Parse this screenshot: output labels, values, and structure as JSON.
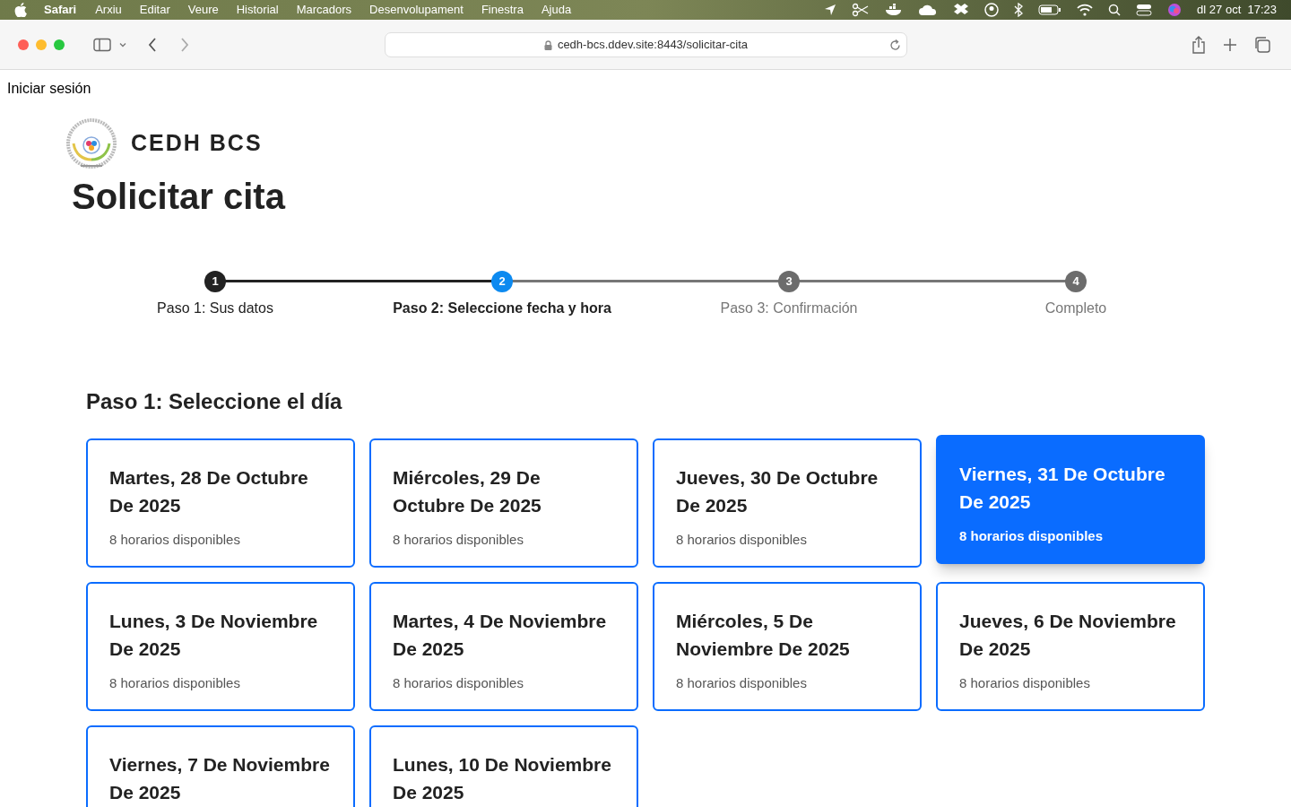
{
  "menu_bar": {
    "app": "Safari",
    "items": [
      "Arxiu",
      "Editar",
      "Veure",
      "Historial",
      "Marcadors",
      "Desenvolupament",
      "Finestra",
      "Ajuda"
    ],
    "clock": "dl 27 oct  17:23"
  },
  "browser": {
    "url": "cedh-bcs.ddev.site:8443/solicitar-cita"
  },
  "login_link": "Iniciar sesión",
  "brand": "CEDH BCS",
  "page_title": "Solicitar cita",
  "steps": [
    {
      "number": "1",
      "label": "Paso 1: Sus datos",
      "completed": true,
      "current": false
    },
    {
      "number": "2",
      "label": "Paso 2: Seleccione fecha y hora",
      "completed": false,
      "current": true
    },
    {
      "number": "3",
      "label": "Paso 3: Confirmación",
      "completed": false,
      "current": false
    },
    {
      "number": "4",
      "label": "Completo",
      "completed": false,
      "current": false
    }
  ],
  "section_title": "Paso 1: Seleccione el día",
  "days": [
    {
      "date": "Martes, 28 De Octubre De 2025",
      "slots": "8 horarios disponibles",
      "selected": false
    },
    {
      "date": "Miércoles, 29 De Octubre De 2025",
      "slots": "8 horarios disponibles",
      "selected": false
    },
    {
      "date": "Jueves, 30 De Octubre De 2025",
      "slots": "8 horarios disponibles",
      "selected": false
    },
    {
      "date": "Viernes, 31 De Octubre De 2025",
      "slots": "8 horarios disponibles",
      "selected": true
    },
    {
      "date": "Lunes, 3 De Noviembre De 2025",
      "slots": "8 horarios disponibles",
      "selected": false
    },
    {
      "date": "Martes, 4 De Noviembre De 2025",
      "slots": "8 horarios disponibles",
      "selected": false
    },
    {
      "date": "Miércoles, 5 De Noviembre De 2025",
      "slots": "8 horarios disponibles",
      "selected": false
    },
    {
      "date": "Jueves, 6 De Noviembre De 2025",
      "slots": "8 horarios disponibles",
      "selected": false
    },
    {
      "date": "Viernes, 7 De Noviembre De 2025",
      "selected": false
    },
    {
      "date": "Lunes, 10 De Noviembre De 2025",
      "selected": false
    }
  ]
}
